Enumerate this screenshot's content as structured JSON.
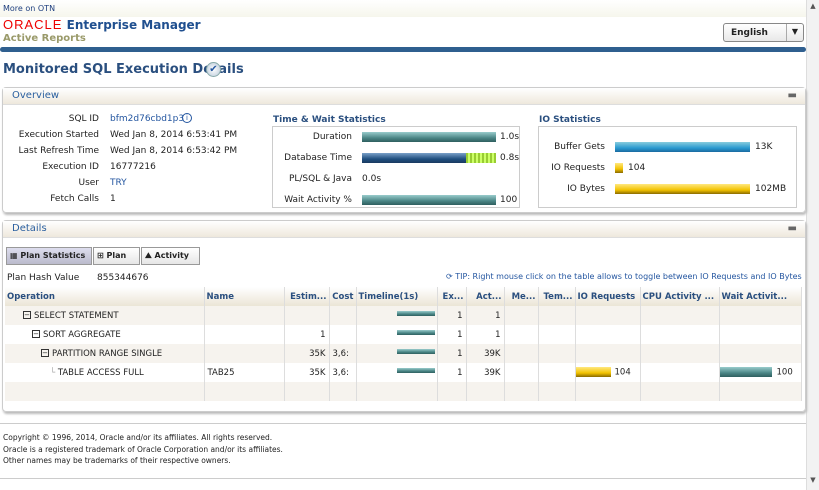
{
  "header": {
    "otn_link": "More on OTN",
    "brand": "ORACLE",
    "product": "Enterprise Manager",
    "subtitle": "Active Reports",
    "language": "English"
  },
  "page_title": "Monitored SQL Execution Details",
  "overview": {
    "title": "Overview",
    "fields": [
      {
        "label": "SQL ID",
        "value": "bfm2d76cbd1p3"
      },
      {
        "label": "Execution Started",
        "value": "Wed Jan 8, 2014 6:53:41 PM"
      },
      {
        "label": "Last Refresh Time",
        "value": "Wed Jan 8, 2014 6:53:42 PM"
      },
      {
        "label": "Execution ID",
        "value": "16777216"
      },
      {
        "label": "User",
        "value": "TRY"
      },
      {
        "label": "Fetch Calls",
        "value": "1"
      }
    ],
    "time_wait": {
      "title": "Time & Wait Statistics",
      "rows": [
        {
          "label": "Duration",
          "value": "1.0s",
          "fraction": 1.0
        },
        {
          "label": "Database Time",
          "value": "0.8s",
          "fraction": 1.0
        },
        {
          "label": "PL/SQL & Java",
          "value": "0.0s",
          "fraction": 0
        },
        {
          "label": "Wait Activity %",
          "value": "100",
          "fraction": 1.0
        }
      ]
    },
    "io": {
      "title": "IO Statistics",
      "rows": [
        {
          "label": "Buffer Gets",
          "value": "13K",
          "fraction": 1.0
        },
        {
          "label": "IO Requests",
          "value": "104",
          "fraction": 0.06
        },
        {
          "label": "IO Bytes",
          "value": "102MB",
          "fraction": 1.0
        }
      ]
    }
  },
  "details": {
    "title": "Details",
    "tabs": [
      "Plan Statistics",
      "Plan",
      "Activity"
    ],
    "plan_hash_label": "Plan Hash Value",
    "plan_hash": "855344676",
    "tip": "TIP: Right mouse click on the table allows to toggle between IO Requests and IO Bytes",
    "columns": [
      "Operation",
      "Name",
      "Estim...",
      "Cost",
      "Timeline(1s)",
      "Ex...",
      "Act...",
      "Me...",
      "Tem...",
      "IO Requests",
      "CPU Activity ...",
      "Wait Activit..."
    ],
    "rows": [
      {
        "op": "SELECT STATEMENT",
        "name": "",
        "estim": "",
        "cost": "",
        "timeline": 1,
        "ex": "1",
        "act": "1",
        "io": "",
        "wait": ""
      },
      {
        "op": "SORT AGGREGATE",
        "name": "",
        "estim": "1",
        "cost": "",
        "timeline": 1,
        "ex": "1",
        "act": "1",
        "io": "",
        "wait": ""
      },
      {
        "op": "PARTITION RANGE SINGLE",
        "name": "",
        "estim": "35K",
        "cost": "3,6:",
        "timeline": 1,
        "ex": "1",
        "act": "39K",
        "io": "",
        "wait": ""
      },
      {
        "op": "TABLE ACCESS FULL",
        "name": "TAB25",
        "estim": "35K",
        "cost": "3,6:",
        "timeline": 1,
        "ex": "1",
        "act": "39K",
        "io": "104",
        "wait": "100"
      }
    ]
  },
  "footer": [
    "Copyright © 1996, 2014, Oracle and/or its affiliates. All rights reserved.",
    "Oracle is a registered trademark of Oracle Corporation and/or its affiliates.",
    "Other names may be trademarks of their respective owners."
  ]
}
